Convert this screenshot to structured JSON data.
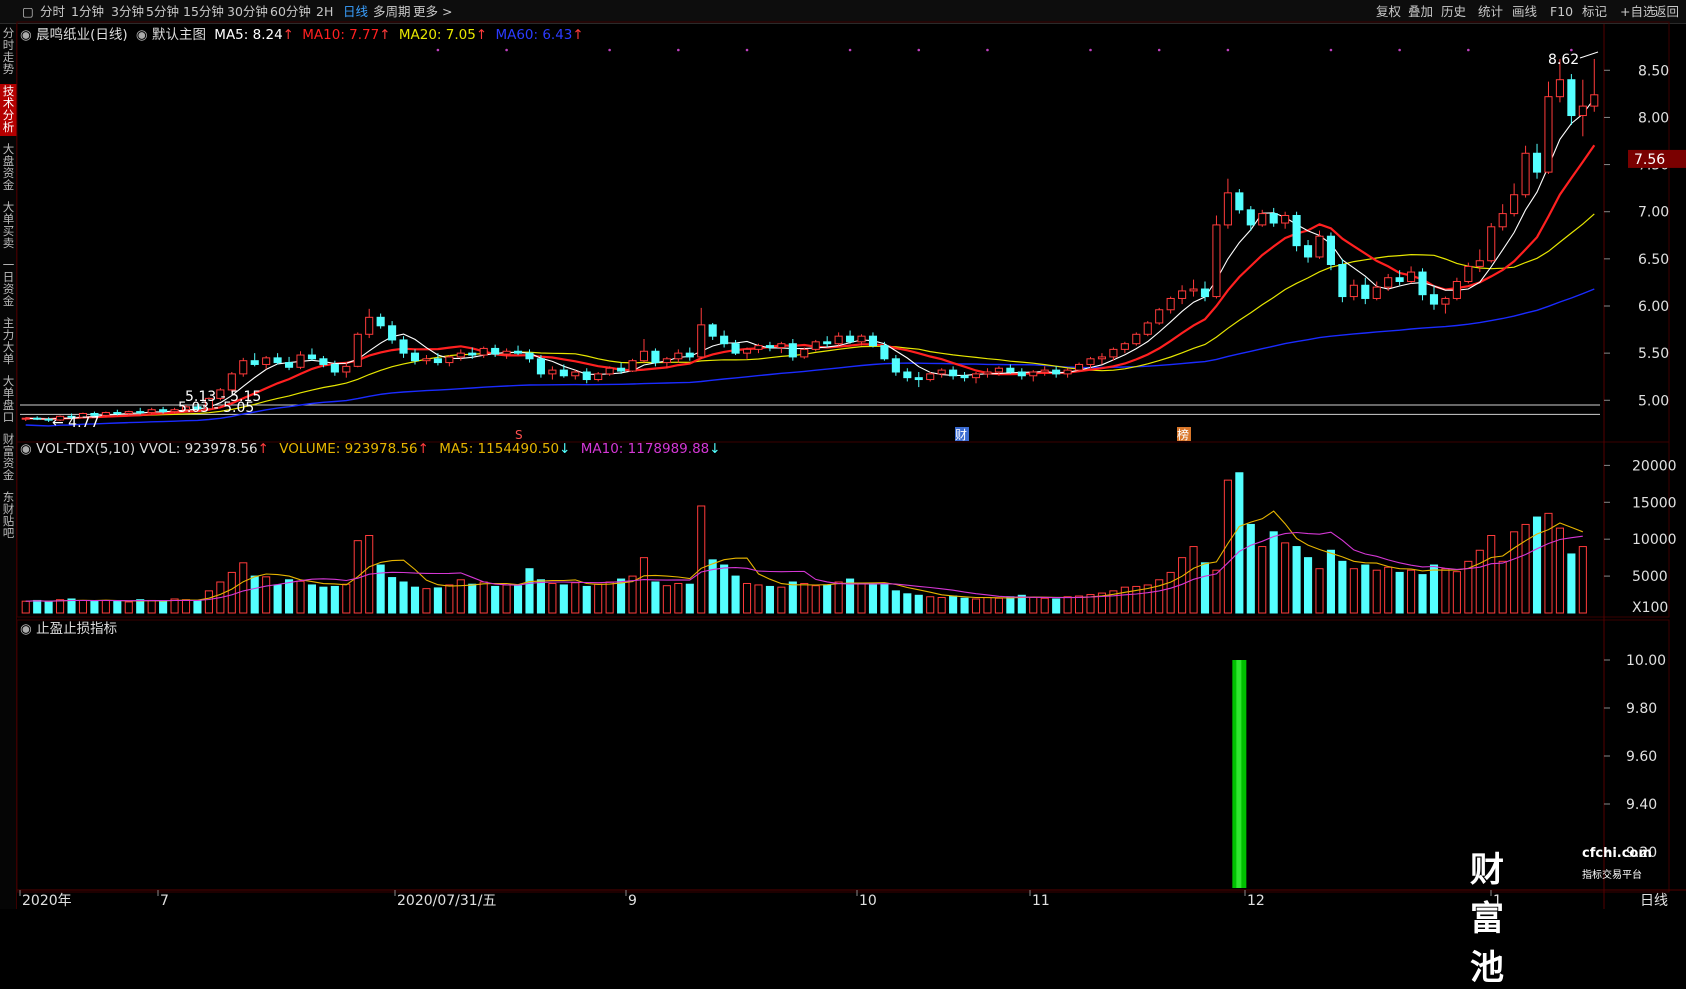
{
  "topbar": {
    "periods": [
      "分时",
      "1分钟",
      "3分钟",
      "5分钟",
      "15分钟",
      "30分钟",
      "60分钟",
      "2H",
      "日线",
      "多周期",
      "更多"
    ],
    "active_period": "日线",
    "tools": [
      "复权",
      "叠加",
      "历史",
      "统计",
      "画线",
      "F10",
      "标记",
      "+自选",
      "返回"
    ]
  },
  "sidetabs": [
    "分时走势",
    "技术分析",
    "大盘资金",
    "大单买卖",
    "一日资金",
    "主力大单",
    "大单盘口",
    "财富资金",
    "东财贴吧"
  ],
  "active_sidetab": "技术分析",
  "main_legend": {
    "stock": "晨鸣纸业(日线)",
    "mode": "默认主图",
    "ma5": "MA5: 8.24",
    "ma10": "MA10: 7.77",
    "ma20": "MA20: 7.05",
    "ma60": "MA60: 6.43"
  },
  "main_annotations": {
    "high": "8.62",
    "low": "4.77",
    "range1": "5.13 - 5.15",
    "range2": "5.03 - 5.05",
    "event1": "S",
    "event2": "财",
    "event3": "榜"
  },
  "price_axis": [
    "8.50",
    "8.00",
    "7.50",
    "7.00",
    "6.50",
    "6.00",
    "5.50",
    "5.00"
  ],
  "current_price": "7.56",
  "vol_legend": {
    "title": "VOL-TDX(5,10)",
    "vvol": "VVOL: 923978.56",
    "volume": "VOLUME: 923978.56",
    "ma5": "MA5: 1154490.50",
    "ma10": "MA10: 1178989.88"
  },
  "vol_axis": [
    "20000",
    "15000",
    "10000",
    "5000",
    "X100"
  ],
  "ind_legend": "止盈止损指标",
  "ind_axis": [
    "10.00",
    "9.80",
    "9.60",
    "9.40",
    "9.20"
  ],
  "date_axis": [
    "2020年",
    "7",
    "2020/07/31/五",
    "9",
    "10",
    "11",
    "12",
    "1"
  ],
  "period_label": "日线",
  "watermark": {
    "brand": "财富池",
    "domain": "cfchi.com",
    "tagline": "指标交易平台"
  },
  "colors": {
    "up": "#ff3b3b",
    "down": "#54ffff",
    "ma5": "#ffffff",
    "ma10": "#ff2020",
    "ma20": "#e6e600",
    "ma60": "#1a2bff",
    "vma10": "#d437d4",
    "bar": "#00c000"
  },
  "chart_data": {
    "type": "candlestick",
    "price_ylim": [
      4.6,
      8.8
    ],
    "candles": [
      [
        4.8,
        4.82,
        4.78,
        4.81
      ],
      [
        4.81,
        4.83,
        4.79,
        4.8
      ],
      [
        4.8,
        4.82,
        4.77,
        4.79
      ],
      [
        4.79,
        4.84,
        4.78,
        4.83
      ],
      [
        4.83,
        4.86,
        4.8,
        4.82
      ],
      [
        4.82,
        4.87,
        4.81,
        4.86
      ],
      [
        4.86,
        4.88,
        4.83,
        4.84
      ],
      [
        4.84,
        4.88,
        4.82,
        4.87
      ],
      [
        4.87,
        4.9,
        4.84,
        4.86
      ],
      [
        4.86,
        4.89,
        4.84,
        4.88
      ],
      [
        4.88,
        4.92,
        4.85,
        4.87
      ],
      [
        4.87,
        4.92,
        4.85,
        4.9
      ],
      [
        4.9,
        4.93,
        4.86,
        4.88
      ],
      [
        4.88,
        4.92,
        4.86,
        4.9
      ],
      [
        4.9,
        4.95,
        4.88,
        4.93
      ],
      [
        4.93,
        4.96,
        4.89,
        4.91
      ],
      [
        4.91,
        5.03,
        4.9,
        5.02
      ],
      [
        5.02,
        5.13,
        5.0,
        5.11
      ],
      [
        5.11,
        5.3,
        5.09,
        5.28
      ],
      [
        5.28,
        5.45,
        5.25,
        5.42
      ],
      [
        5.42,
        5.5,
        5.36,
        5.38
      ],
      [
        5.38,
        5.47,
        5.33,
        5.45
      ],
      [
        5.45,
        5.5,
        5.38,
        5.4
      ],
      [
        5.4,
        5.46,
        5.32,
        5.35
      ],
      [
        5.35,
        5.52,
        5.33,
        5.48
      ],
      [
        5.48,
        5.55,
        5.42,
        5.44
      ],
      [
        5.44,
        5.47,
        5.35,
        5.38
      ],
      [
        5.38,
        5.42,
        5.26,
        5.3
      ],
      [
        5.3,
        5.4,
        5.24,
        5.36
      ],
      [
        5.36,
        5.72,
        5.35,
        5.7
      ],
      [
        5.7,
        5.97,
        5.66,
        5.88
      ],
      [
        5.88,
        5.92,
        5.76,
        5.79
      ],
      [
        5.79,
        5.84,
        5.6,
        5.64
      ],
      [
        5.64,
        5.68,
        5.45,
        5.5
      ],
      [
        5.5,
        5.54,
        5.38,
        5.42
      ],
      [
        5.42,
        5.48,
        5.38,
        5.44
      ],
      [
        5.44,
        5.5,
        5.37,
        5.4
      ],
      [
        5.4,
        5.48,
        5.36,
        5.46
      ],
      [
        5.46,
        5.54,
        5.42,
        5.5
      ],
      [
        5.5,
        5.56,
        5.44,
        5.48
      ],
      [
        5.48,
        5.57,
        5.45,
        5.55
      ],
      [
        5.55,
        5.59,
        5.46,
        5.49
      ],
      [
        5.49,
        5.55,
        5.44,
        5.52
      ],
      [
        5.52,
        5.58,
        5.48,
        5.5
      ],
      [
        5.5,
        5.54,
        5.4,
        5.44
      ],
      [
        5.44,
        5.48,
        5.24,
        5.28
      ],
      [
        5.28,
        5.36,
        5.22,
        5.32
      ],
      [
        5.32,
        5.38,
        5.24,
        5.26
      ],
      [
        5.26,
        5.32,
        5.22,
        5.3
      ],
      [
        5.3,
        5.34,
        5.18,
        5.22
      ],
      [
        5.22,
        5.3,
        5.2,
        5.28
      ],
      [
        5.28,
        5.36,
        5.26,
        5.34
      ],
      [
        5.34,
        5.4,
        5.28,
        5.31
      ],
      [
        5.31,
        5.44,
        5.3,
        5.42
      ],
      [
        5.42,
        5.65,
        5.4,
        5.52
      ],
      [
        5.52,
        5.55,
        5.36,
        5.4
      ],
      [
        5.4,
        5.46,
        5.34,
        5.44
      ],
      [
        5.44,
        5.54,
        5.4,
        5.5
      ],
      [
        5.5,
        5.56,
        5.42,
        5.46
      ],
      [
        5.46,
        5.98,
        5.44,
        5.8
      ],
      [
        5.8,
        5.82,
        5.64,
        5.68
      ],
      [
        5.68,
        5.74,
        5.56,
        5.6
      ],
      [
        5.6,
        5.64,
        5.48,
        5.5
      ],
      [
        5.5,
        5.56,
        5.44,
        5.54
      ],
      [
        5.54,
        5.6,
        5.5,
        5.58
      ],
      [
        5.58,
        5.62,
        5.52,
        5.56
      ],
      [
        5.56,
        5.62,
        5.5,
        5.6
      ],
      [
        5.6,
        5.65,
        5.42,
        5.46
      ],
      [
        5.46,
        5.56,
        5.44,
        5.54
      ],
      [
        5.54,
        5.64,
        5.52,
        5.62
      ],
      [
        5.62,
        5.68,
        5.56,
        5.6
      ],
      [
        5.6,
        5.72,
        5.58,
        5.68
      ],
      [
        5.68,
        5.74,
        5.6,
        5.62
      ],
      [
        5.62,
        5.7,
        5.58,
        5.68
      ],
      [
        5.68,
        5.72,
        5.56,
        5.58
      ],
      [
        5.58,
        5.62,
        5.42,
        5.44
      ],
      [
        5.44,
        5.48,
        5.26,
        5.3
      ],
      [
        5.3,
        5.34,
        5.2,
        5.24
      ],
      [
        5.24,
        5.3,
        5.14,
        5.22
      ],
      [
        5.22,
        5.3,
        5.2,
        5.28
      ],
      [
        5.28,
        5.34,
        5.24,
        5.32
      ],
      [
        5.32,
        5.36,
        5.22,
        5.26
      ],
      [
        5.26,
        5.3,
        5.2,
        5.24
      ],
      [
        5.24,
        5.3,
        5.18,
        5.28
      ],
      [
        5.28,
        5.34,
        5.24,
        5.3
      ],
      [
        5.3,
        5.36,
        5.26,
        5.34
      ],
      [
        5.34,
        5.38,
        5.28,
        5.3
      ],
      [
        5.3,
        5.34,
        5.22,
        5.26
      ],
      [
        5.26,
        5.32,
        5.2,
        5.3
      ],
      [
        5.3,
        5.36,
        5.26,
        5.32
      ],
      [
        5.32,
        5.36,
        5.24,
        5.28
      ],
      [
        5.28,
        5.34,
        5.24,
        5.32
      ],
      [
        5.32,
        5.4,
        5.3,
        5.38
      ],
      [
        5.38,
        5.46,
        5.34,
        5.44
      ],
      [
        5.44,
        5.5,
        5.38,
        5.46
      ],
      [
        5.46,
        5.56,
        5.42,
        5.54
      ],
      [
        5.54,
        5.62,
        5.5,
        5.6
      ],
      [
        5.6,
        5.72,
        5.58,
        5.7
      ],
      [
        5.7,
        5.84,
        5.68,
        5.82
      ],
      [
        5.82,
        5.98,
        5.8,
        5.96
      ],
      [
        5.96,
        6.1,
        5.92,
        6.08
      ],
      [
        6.08,
        6.22,
        6.02,
        6.16
      ],
      [
        6.16,
        6.28,
        6.1,
        6.18
      ],
      [
        6.18,
        6.26,
        6.05,
        6.1
      ],
      [
        6.1,
        6.96,
        6.08,
        6.86
      ],
      [
        6.86,
        7.35,
        6.82,
        7.2
      ],
      [
        7.2,
        7.24,
        6.98,
        7.02
      ],
      [
        7.02,
        7.06,
        6.8,
        6.86
      ],
      [
        6.86,
        7.02,
        6.84,
        6.98
      ],
      [
        6.98,
        7.04,
        6.84,
        6.88
      ],
      [
        6.88,
        7.0,
        6.82,
        6.96
      ],
      [
        6.96,
        7.0,
        6.58,
        6.64
      ],
      [
        6.64,
        6.7,
        6.46,
        6.52
      ],
      [
        6.52,
        6.8,
        6.5,
        6.74
      ],
      [
        6.74,
        6.78,
        6.38,
        6.44
      ],
      [
        6.44,
        6.5,
        6.04,
        6.1
      ],
      [
        6.1,
        6.28,
        6.06,
        6.22
      ],
      [
        6.22,
        6.3,
        6.02,
        6.08
      ],
      [
        6.08,
        6.26,
        6.06,
        6.2
      ],
      [
        6.2,
        6.34,
        6.16,
        6.3
      ],
      [
        6.3,
        6.38,
        6.22,
        6.26
      ],
      [
        6.26,
        6.42,
        6.24,
        6.36
      ],
      [
        6.36,
        6.4,
        6.06,
        6.12
      ],
      [
        6.12,
        6.22,
        5.96,
        6.02
      ],
      [
        6.02,
        6.1,
        5.92,
        6.08
      ],
      [
        6.08,
        6.3,
        6.06,
        6.26
      ],
      [
        6.26,
        6.46,
        6.24,
        6.42
      ],
      [
        6.42,
        6.6,
        6.36,
        6.48
      ],
      [
        6.48,
        6.88,
        6.46,
        6.84
      ],
      [
        6.84,
        7.08,
        6.8,
        6.98
      ],
      [
        6.98,
        7.3,
        6.95,
        7.18
      ],
      [
        7.18,
        7.7,
        7.15,
        7.62
      ],
      [
        7.62,
        7.72,
        7.35,
        7.42
      ],
      [
        7.42,
        8.38,
        7.4,
        8.22
      ],
      [
        8.22,
        8.62,
        8.16,
        8.4
      ],
      [
        8.4,
        8.46,
        7.92,
        8.02
      ],
      [
        8.02,
        8.4,
        7.8,
        8.12
      ],
      [
        8.12,
        8.62,
        8.06,
        8.24
      ]
    ],
    "volume": [
      1600,
      1700,
      1500,
      1800,
      1900,
      1700,
      1600,
      1700,
      1600,
      1500,
      1800,
      1700,
      1600,
      1900,
      1800,
      1700,
      3000,
      4200,
      5500,
      6800,
      5000,
      4900,
      3800,
      4500,
      4300,
      3800,
      3500,
      3600,
      3900,
      9800,
      10500,
      6500,
      4800,
      4200,
      3500,
      3300,
      3400,
      3800,
      4500,
      3900,
      4200,
      3600,
      3800,
      3700,
      6000,
      4500,
      4000,
      3800,
      4100,
      3600,
      3900,
      4200,
      4600,
      5000,
      7500,
      4200,
      3700,
      4000,
      3900,
      14500,
      7200,
      6500,
      5000,
      4000,
      3800,
      3600,
      3500,
      4200,
      4000,
      3700,
      3800,
      4200,
      4600,
      4000,
      3800,
      3900,
      3000,
      2600,
      2400,
      2200,
      2100,
      2300,
      2000,
      1900,
      2100,
      2000,
      2200,
      2400,
      2100,
      2000,
      1900,
      2200,
      2300,
      2500,
      2700,
      3000,
      3500,
      3600,
      3800,
      4500,
      5500,
      7500,
      9000,
      6800,
      5800,
      18000,
      19000,
      12000,
      9000,
      11000,
      9500,
      9000,
      7500,
      6000,
      8500,
      7000,
      6000,
      6500,
      5800,
      6200,
      5500,
      5800,
      5200,
      6500,
      6000,
      5600,
      7000,
      8500,
      10500,
      7000,
      11000,
      12000,
      13000,
      13500,
      11500,
      8000,
      9000
    ],
    "indicator_ylim": [
      9.05,
      10.1
    ],
    "indicator_bar": {
      "index": 106,
      "value": 10.0
    }
  }
}
